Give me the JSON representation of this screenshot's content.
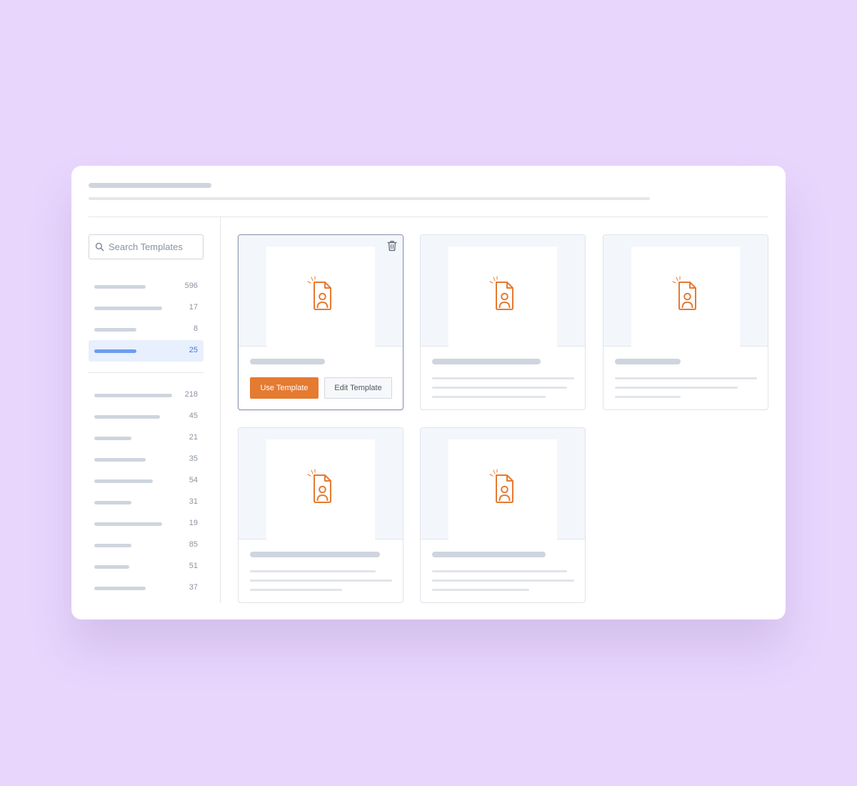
{
  "search": {
    "placeholder": "Search Templates",
    "icon": "search-icon"
  },
  "categories_group1": [
    {
      "count": "596",
      "active": false
    },
    {
      "count": "17",
      "active": false
    },
    {
      "count": "8",
      "active": false
    },
    {
      "count": "25",
      "active": true
    }
  ],
  "categories_group2": [
    {
      "count": "218"
    },
    {
      "count": "45"
    },
    {
      "count": "21"
    },
    {
      "count": "35"
    },
    {
      "count": "54"
    },
    {
      "count": "31"
    },
    {
      "count": "19"
    },
    {
      "count": "85"
    },
    {
      "count": "51"
    },
    {
      "count": "37"
    }
  ],
  "selected_card": {
    "use_label": "Use Template",
    "edit_label": "Edit Template",
    "delete_icon": "trash-icon"
  },
  "card_icon": "document-user-icon",
  "colors": {
    "background": "#e8d6fd",
    "accent": "#e57a31",
    "active_highlight": "#e8effd",
    "active_text": "#3b7be6"
  }
}
